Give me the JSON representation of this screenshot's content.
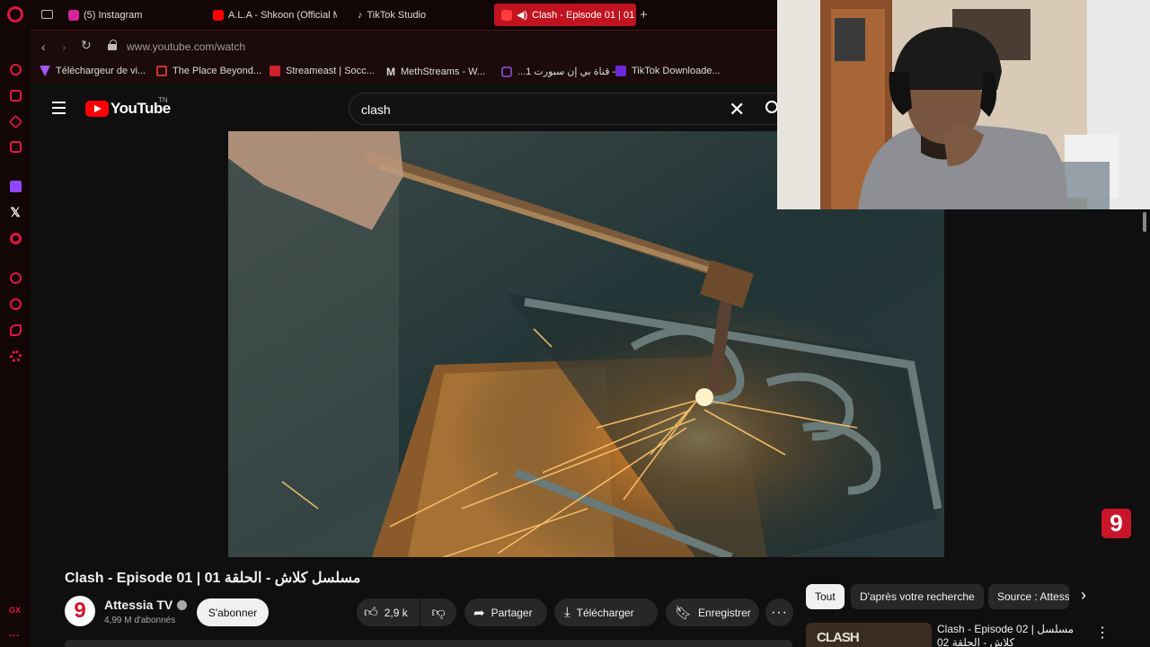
{
  "browser": {
    "tabs": [
      {
        "label": "(5) Instagram",
        "icon": "instagram-icon",
        "color": "#d6249f"
      },
      {
        "label": "A.L.A - Shkoon (Official M",
        "icon": "youtube-icon",
        "color": "#ff0000"
      },
      {
        "label": "TikTok Studio",
        "icon": "tiktok-icon",
        "color": "#ffffff"
      },
      {
        "label": "Clash - Episode 01 | 01",
        "icon": "youtube-icon",
        "color": "#ff0000",
        "active": true
      }
    ],
    "new_tab": "+",
    "url": "www.youtube.com/watch",
    "bookmarks": [
      {
        "label": "Téléchargeur de vi...",
        "icon": "downloader-icon",
        "color": "#a855f7"
      },
      {
        "label": "The Place Beyond...",
        "icon": "tv-icon",
        "color": "#d03030"
      },
      {
        "label": "Streameast | Socc...",
        "icon": "streameast-icon",
        "color": "#d0202a"
      },
      {
        "label": "MethStreams - W...",
        "icon": "gmail-m-icon",
        "color": "#ffffff"
      },
      {
        "label": "...قناة بي إن سبورت 1 –",
        "icon": "bein-icon",
        "color": "#7b3fb0"
      },
      {
        "label": "TikTok Downloade...",
        "icon": "tiktok-downloader-icon",
        "color": "#6d28d9"
      }
    ],
    "sidebar_label": "GX",
    "accent_color": "#e0183c"
  },
  "youtube": {
    "logo_text": "YouTube",
    "country_code": "TN",
    "search_query": "clash",
    "video": {
      "title": "Clash - Episode 01 | 01 مسلسل كلاش - الحلقة",
      "watermark": "9"
    },
    "channel": {
      "name": "Attessia TV",
      "avatar_text": "9",
      "subscribers": "4,99 M d'abonnés",
      "subscribe_label": "S'abonner"
    },
    "actions": {
      "likes": "2,9 k",
      "share": "Partager",
      "download": "Télécharger",
      "save": "Enregistrer"
    },
    "chips": [
      "Tout",
      "D'après votre recherche",
      "Source : Attessia TV"
    ],
    "recommendation": {
      "thumb_text": "CLASH",
      "title": "Clash - Episode 02 | مسلسل كلاش - الحلقة 02"
    }
  }
}
